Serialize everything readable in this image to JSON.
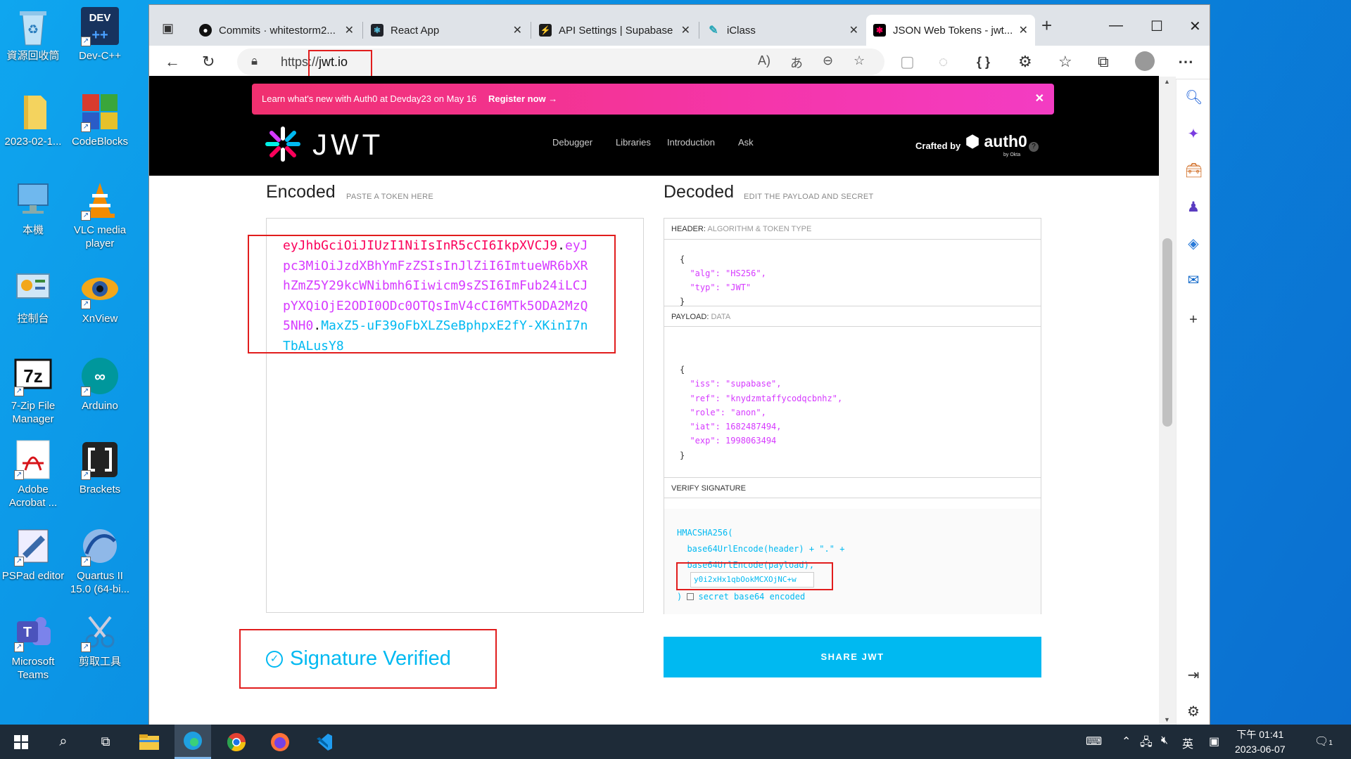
{
  "desktop": {
    "icons": [
      {
        "name": "recycle-bin",
        "label": "資源回收筒"
      },
      {
        "name": "dev-cpp",
        "label": "Dev-C++"
      },
      {
        "name": "folder-2023",
        "label": "2023-02-1..."
      },
      {
        "name": "codeblocks",
        "label": "CodeBlocks"
      },
      {
        "name": "this-pc",
        "label": "本機"
      },
      {
        "name": "vlc",
        "label": "VLC media player"
      },
      {
        "name": "control-panel",
        "label": "控制台"
      },
      {
        "name": "xnview",
        "label": "XnView"
      },
      {
        "name": "7zip",
        "label": "7-Zip File Manager"
      },
      {
        "name": "arduino",
        "label": "Arduino"
      },
      {
        "name": "adobe-acrobat",
        "label": "Adobe Acrobat ..."
      },
      {
        "name": "brackets",
        "label": "Brackets"
      },
      {
        "name": "pspad",
        "label": "PSPad editor"
      },
      {
        "name": "quartus",
        "label": "Quartus II 15.0 (64-bi..."
      },
      {
        "name": "teams",
        "label": "Microsoft Teams"
      },
      {
        "name": "snipping-tool",
        "label": "剪取工具"
      }
    ]
  },
  "browser": {
    "tabs": [
      {
        "title": "Commits · whitestorm2...",
        "icon": "github-icon"
      },
      {
        "title": "React App",
        "icon": "react-icon"
      },
      {
        "title": "API Settings | Supabase",
        "icon": "supabase-icon"
      },
      {
        "title": "iClass",
        "icon": "iclass-icon"
      },
      {
        "title": "JSON Web Tokens - jwt...",
        "icon": "jwt-icon",
        "active": true
      }
    ],
    "url_prefix": "https://",
    "url_host": "jwt.io"
  },
  "page": {
    "banner": {
      "message": "Learn what's new with Auth0 at Devday23 on May 16",
      "cta": "Register now →"
    },
    "logo_text": "JWT",
    "nav": [
      "Debugger",
      "Libraries",
      "Introduction",
      "Ask"
    ],
    "crafted_by": "Crafted by",
    "auth0": "auth0",
    "by_okta": "by Okta",
    "encoded_title": "Encoded",
    "encoded_sub": "PASTE A TOKEN HERE",
    "decoded_title": "Decoded",
    "decoded_sub": "EDIT THE PAYLOAD AND SECRET",
    "token": {
      "header": "eyJhbGciOiJIUzI1NiIsInR5cCI6IkpXVCJ9",
      "payload": "eyJpc3MiOiJzdXBhYmFzZSIsInJlZiI6ImtueWR6bXRhZmZ5Y29kcWNibmh6Iiwicm9sZSI6ImFub24iLCJpYXQiOjE2ODI0ODc0OTQsImV4cCI6MTk5ODA2MzQ5NH0",
      "signature": "MaxZ5-uF39oFbXLZSeBphpxE2fY-XKinI7nTbALusY8"
    },
    "header_section": {
      "label": "HEADER:",
      "sub": "ALGORITHM & TOKEN TYPE",
      "lines": [
        "{",
        "  \"alg\": \"HS256\",",
        "  \"typ\": \"JWT\"",
        "}"
      ]
    },
    "payload_section": {
      "label": "PAYLOAD:",
      "sub": "DATA",
      "lines": [
        "{",
        "  \"iss\": \"supabase\",",
        "  \"ref\": \"knydzmtaffycodqcbnhz\",",
        "  \"role\": \"anon\",",
        "  \"iat\": 1682487494,",
        "  \"exp\": 1998063494",
        "}"
      ]
    },
    "verify_section": {
      "label": "VERIFY SIGNATURE",
      "line1": "HMACSHA256(",
      "line2": "  base64UrlEncode(header) + \".\" +",
      "line3": "  base64UrlEncode(payload),",
      "secret": "y0i2xHx1qbOokMCXOjNC+w",
      "b64_label": "secret base64 encoded",
      "close": ")"
    },
    "signature_status": "Signature Verified",
    "share_label": "SHARE JWT"
  },
  "taskbar": {
    "clock_time": "下午 01:41",
    "clock_date": "2023-06-07",
    "ime": "英",
    "notifications": "1"
  }
}
